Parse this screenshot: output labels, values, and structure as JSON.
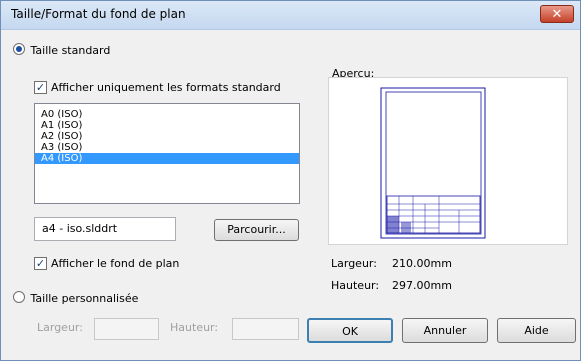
{
  "window": {
    "title": "Taille/Format du fond de plan",
    "close_symbol": "✕"
  },
  "standard": {
    "radio_label": "Taille standard",
    "checkbox_label": "Afficher uniquement les formats standard",
    "formats": [
      "A0 (ISO)",
      "A1 (ISO)",
      "A2 (ISO)",
      "A3 (ISO)",
      "A4 (ISO)"
    ],
    "selected_format": "A4 (ISO)",
    "file_value": "a4 - iso.slddrt",
    "browse_label": "Parcourir...",
    "show_sheet_label": "Afficher le fond de plan"
  },
  "preview": {
    "label": "Aperçu:",
    "width_label": "Largeur:",
    "width_value": "210.00mm",
    "height_label": "Hauteur:",
    "height_value": "297.00mm"
  },
  "custom": {
    "radio_label": "Taille personnalisée",
    "width_label": "Largeur:",
    "height_label": "Hauteur:"
  },
  "buttons": {
    "ok": "OK",
    "cancel": "Annuler",
    "help": "Aide"
  },
  "colors": {
    "selection": "#3399ff",
    "preview_lines": "#1a1aa8",
    "titlebar": "#c5d8f0",
    "close": "#c5402a"
  }
}
